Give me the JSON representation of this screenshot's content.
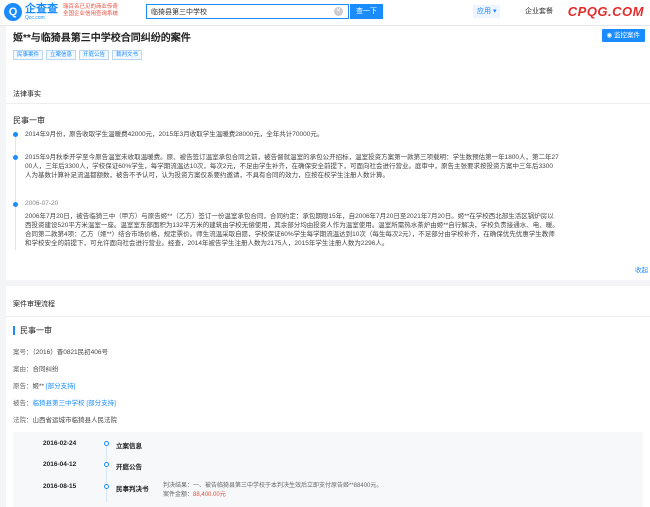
{
  "header": {
    "logo_mark": "Q",
    "logo_cn": "企查查",
    "logo_en": "Qcc.com",
    "promo_line1": "瑞百名已见的商业传奇",
    "promo_line2": "全国企业信用查询系统",
    "search_value": "临猗县第三中学校",
    "search_button": "查一下",
    "nav_app": "应用 ▾",
    "nav_ent": "企业套餐",
    "watermark": "CPQG.COM"
  },
  "title_card": {
    "title": "姬**与临猗县第三中学校合同纠纷的案件",
    "monitor_button": "监控案件",
    "tags": [
      "民事案件",
      "立案信息",
      "开庭公告",
      "裁判文书"
    ]
  },
  "facts": {
    "section_title": "法律事实",
    "subhead": "民事一审",
    "items": [
      {
        "date": "",
        "text": "2014年9月份，原告收取学生温暖费42000元，2015年3月收取学生温暖费28000元，全年共计70000元。"
      },
      {
        "date": "",
        "text_l1": "2015年9月秋季开学至今原告温室未收取温暖费。原、被告签订温室承包合同之前，被告督就温室的承包公开招标，温室投资方案第一款第三项载明：学生数预估第一年1800人，第二年27",
        "text_l2": "00人，三年后3300人，学校保证60%学生，每学期流温达10次，每次2元，不足由学生补齐，在确保安全前提下，可面向社会进行营业。庭审中，原告主张要求按投资方案中三年后3300",
        "text_l3": "人为基数计算补足流温都额数，被告不予认可，认为投资方案仅系要约邀请，不具有合同的效力，应按在校学生注册人数计算。"
      },
      {
        "date": "2006-07-20",
        "text_l1": "2006年7月20日，被告临猗三中（甲方）与原告姬**（乙方）签订一份温室承包合同，合同约定：承包期限15年，自2006年7月20日至2021年7月20日。姬**在学校西北部生活区锅炉房以",
        "text_l2": "西投资建设520平方米温室一座。温室室东部面积为132平方米的建筑由学校无偿使用，其余部分均由投资人作为温室使用。温室所需热水茶炉由姬**自行解决，学校负责接通水、电、暖。",
        "text_l3": "合同第二款第4项：乙方（姬**）结合市场价格，规定票价。师生流温采取自愿，学校保证60%学生每学期流温达到10次（每生每次2元），不足部分由学校补齐，在确保优先优惠学生教师",
        "text_l4": "和学校安全的前提下，可允许面向社会进行营业。经查，2014年被告学生注册人数为2175人，2015年学生注册人数为2296人。"
      }
    ],
    "collapse": "收起"
  },
  "process": {
    "section_title": "案件审理流程",
    "subhead": "民事一审",
    "case_no_label": "案号：",
    "case_no": "（2016）晋0821民初406号",
    "cause_label": "案由：",
    "cause": "合同纠纷",
    "plaintiff_label": "原告：",
    "plaintiff": "姬**",
    "plaintiff_result": "[部分支持]",
    "defendant_label": "被告：",
    "defendant": "临猗县第三中学校",
    "defendant_result": "[部分支持]",
    "court_label": "法院：",
    "court": "山西省运城市临猗县人民法院",
    "steps": [
      {
        "date": "2016-02-24",
        "label": "立案信息"
      },
      {
        "date": "2016-04-12",
        "label": "开庭公告"
      },
      {
        "date": "2016-08-15",
        "label": "民事判决书",
        "result_label": "判决结果：",
        "result": "一、被告临猗县第三中学校于本判决生效后立即支付原告姬**88400元。",
        "amount_label": "案件金额：",
        "amount": "88,400.00元"
      }
    ]
  },
  "colors": {
    "accent": "#1a8cff",
    "warn": "#e84d3d"
  }
}
